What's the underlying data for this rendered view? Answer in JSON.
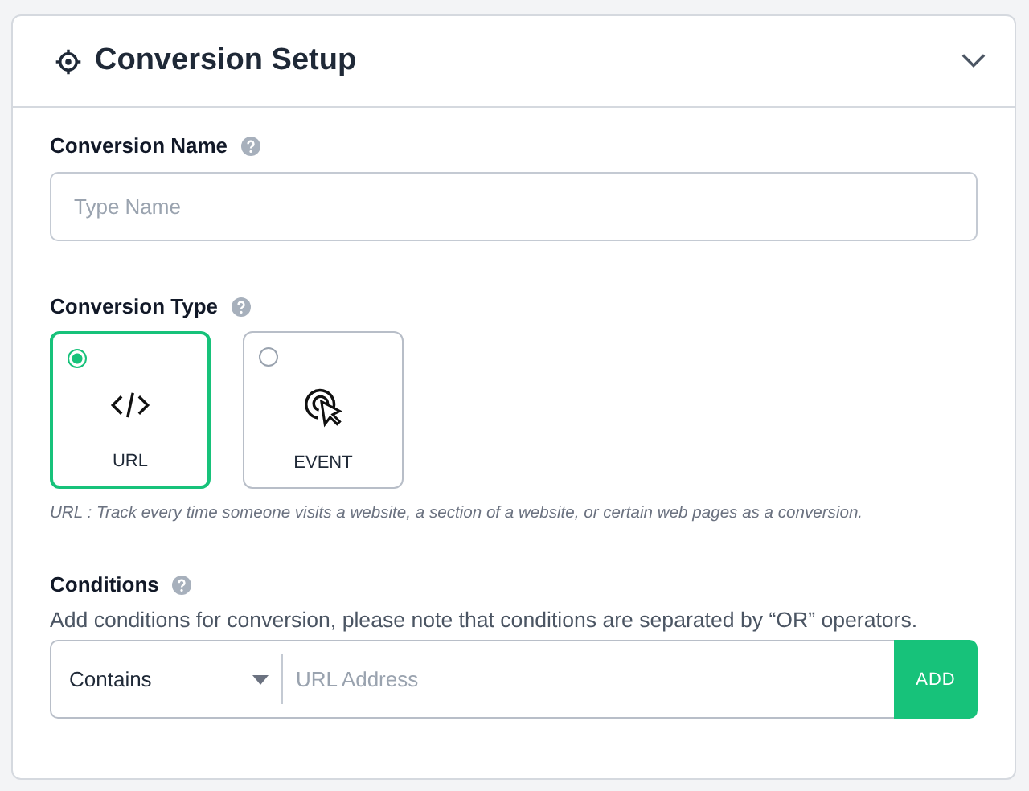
{
  "panel": {
    "title": "Conversion Setup",
    "expanded": true
  },
  "name_field": {
    "label": "Conversion Name",
    "placeholder": "Type Name"
  },
  "type_field": {
    "label": "Conversion Type",
    "options": [
      {
        "label": "URL",
        "kind": "code",
        "selected": true
      },
      {
        "label": "EVENT",
        "kind": "click",
        "selected": false
      }
    ],
    "description": "URL : Track every time someone visits a website, a section of a website, or certain web pages as a conversion."
  },
  "conditions": {
    "label": "Conditions",
    "help": "Add conditions for conversion, please note that conditions are separated by “OR” operators.",
    "operator": "Contains",
    "placeholder": "URL Address",
    "button": "ADD"
  }
}
